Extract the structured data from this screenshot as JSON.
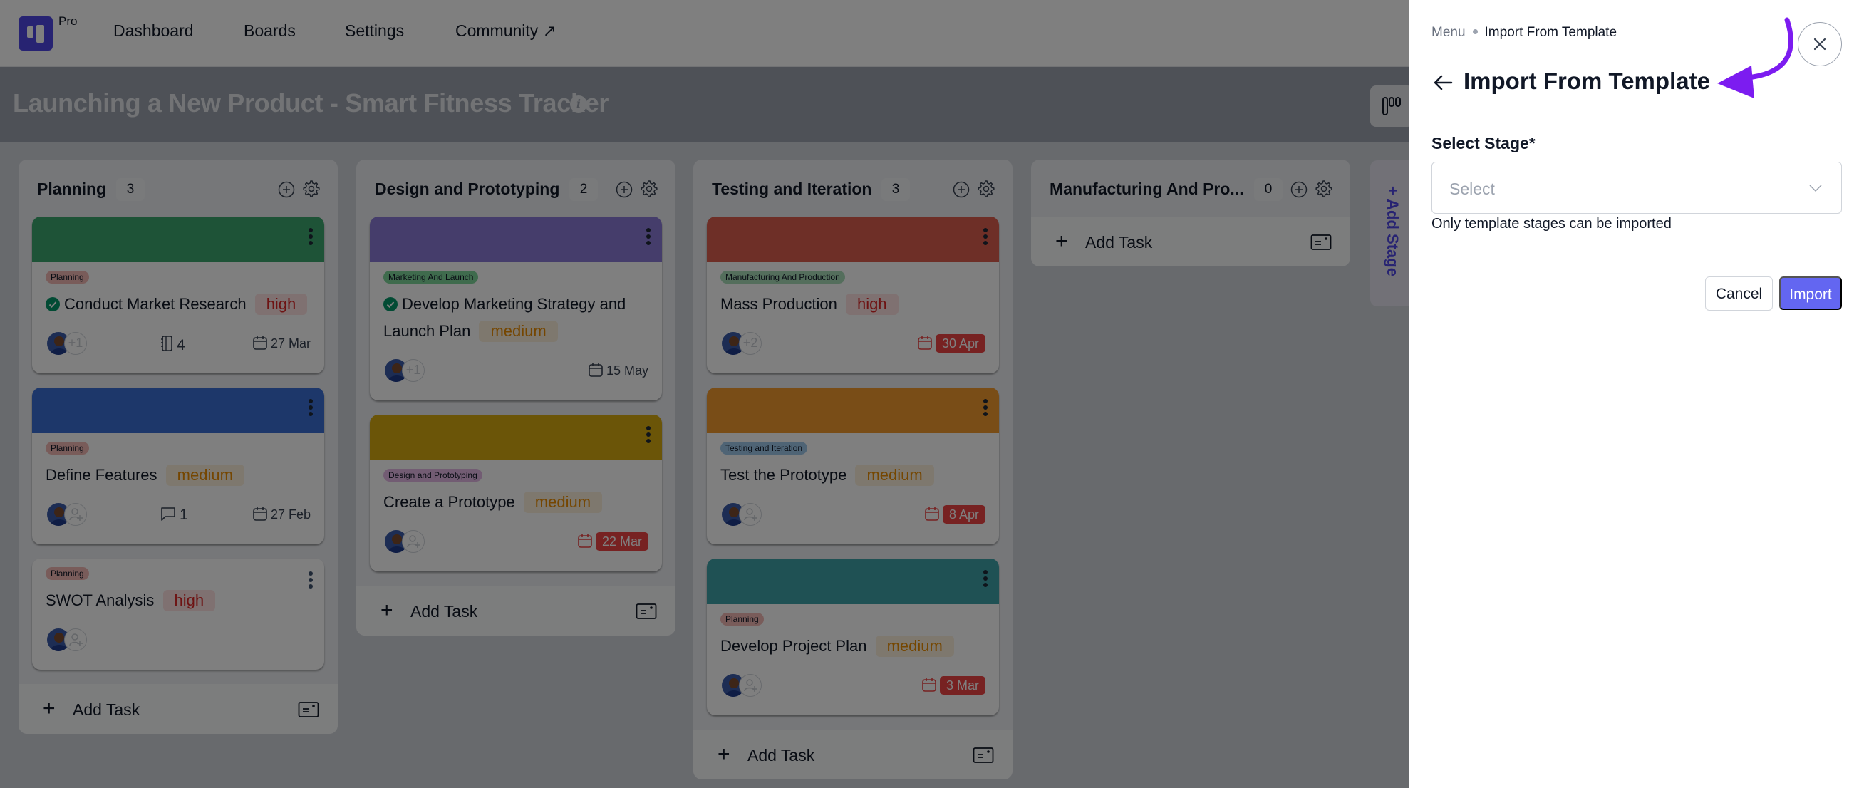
{
  "nav": {
    "logo_badge": "Pro",
    "items": [
      "Dashboard",
      "Boards",
      "Settings",
      "Community ↗"
    ]
  },
  "board": {
    "title": "Launching a New Product - Smart Fitness Tracker",
    "add_stage_label": "+ Add Stage",
    "add_task_label": "Add Task",
    "columns": [
      {
        "title": "Planning",
        "count": "3",
        "cards": [
          {
            "cover": "#3ca66e",
            "tag": "Planning",
            "tag_color": "#f2b8b5",
            "title": "Conduct Market Research",
            "done": true,
            "priority": "high",
            "assignee_extra": "+1",
            "meta_icon": "subtask-icon",
            "meta_value": "4",
            "date": "27 Mar",
            "overdue": false
          },
          {
            "cover": "#3b6fd4",
            "tag": "Planning",
            "tag_color": "#f2b8b5",
            "title": "Define Features",
            "done": false,
            "priority": "medium",
            "assignee_extra": "add-user",
            "meta_icon": "comment-icon",
            "meta_value": "1",
            "date": "27 Feb",
            "overdue": false
          },
          {
            "cover": null,
            "tag": "Planning",
            "tag_color": "#f2b8b5",
            "title": "SWOT Analysis",
            "done": false,
            "priority": "high",
            "assignee_extra": "add-user",
            "meta_icon": null,
            "meta_value": null,
            "date": null,
            "overdue": false
          }
        ]
      },
      {
        "title": "Design and Prototyping",
        "count": "2",
        "cards": [
          {
            "cover": "#8a7ad6",
            "tag": "Marketing And Launch",
            "tag_color": "#7ed69a",
            "title": "Develop Marketing Strategy and Launch Plan",
            "done": true,
            "priority": "medium",
            "assignee_extra": "+1",
            "meta_icon": null,
            "meta_value": null,
            "date": "15 May",
            "overdue": false
          },
          {
            "cover": "#d6aa10",
            "tag": "Design and Prototyping",
            "tag_color": "#e5b8e6",
            "title": "Create a Prototype",
            "done": false,
            "priority": "medium",
            "assignee_extra": "add-user",
            "meta_icon": null,
            "meta_value": null,
            "date": "22 Mar",
            "overdue": true
          }
        ]
      },
      {
        "title": "Testing and Iteration",
        "count": "3",
        "cards": [
          {
            "cover": "#dc5e4f",
            "tag": "Manufacturing And Production",
            "tag_color": "#a8dcb8",
            "title": "Mass Production",
            "done": false,
            "priority": "high",
            "assignee_extra": "+2",
            "meta_icon": null,
            "meta_value": null,
            "date": "30 Apr",
            "overdue": true
          },
          {
            "cover": "#f29a2e",
            "tag": "Testing and Iteration",
            "tag_color": "#9ec8ea",
            "title": "Test the Prototype",
            "done": false,
            "priority": "medium",
            "assignee_extra": "add-user",
            "meta_icon": null,
            "meta_value": null,
            "date": "8 Apr",
            "overdue": true
          },
          {
            "cover": "#3fa3a8",
            "tag": "Planning",
            "tag_color": "#f2b8b5",
            "title": "Develop Project Plan",
            "done": false,
            "priority": "medium",
            "assignee_extra": "add-user",
            "meta_icon": null,
            "meta_value": null,
            "date": "3 Mar",
            "overdue": true
          }
        ]
      },
      {
        "title": "Manufacturing And Pro...",
        "count": "0",
        "cards": []
      }
    ]
  },
  "drawer": {
    "breadcrumb": [
      "Menu",
      "Import From Template"
    ],
    "title": "Import From Template",
    "field_label": "Select Stage*",
    "select_placeholder": "Select",
    "hint": "Only template stages can be imported",
    "cancel_label": "Cancel",
    "import_label": "Import"
  },
  "colors": {
    "accent": "#6366f1",
    "annotation_arrow": "#7c1cf0",
    "overdue": "#ef4444"
  }
}
